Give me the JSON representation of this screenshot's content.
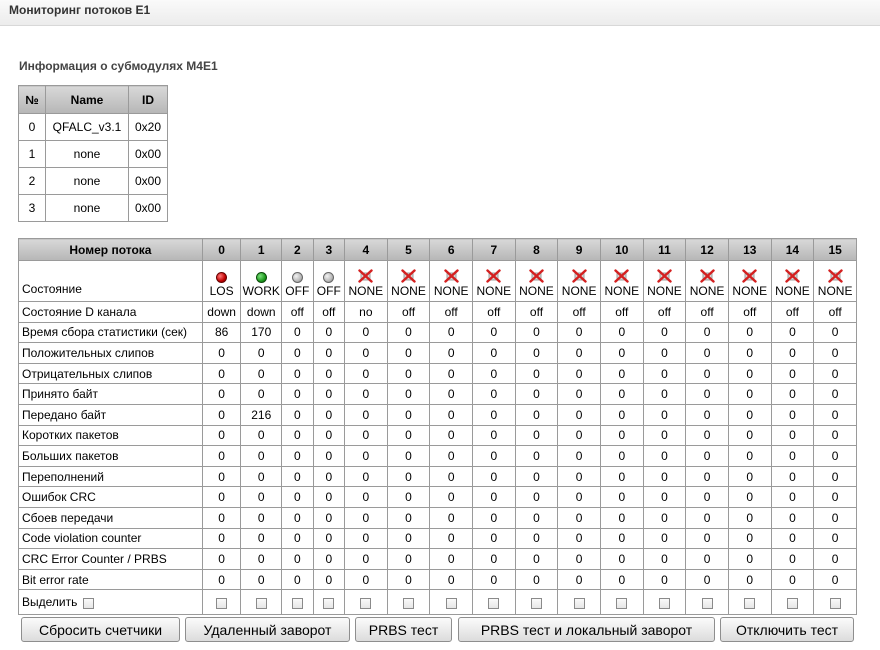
{
  "window": {
    "title": "Мониторинг потоков E1"
  },
  "submodules": {
    "heading": "Информация о субмодулях M4E1",
    "columns": [
      "№",
      "Name",
      "ID"
    ],
    "rows": [
      [
        "0",
        "QFALC_v3.1",
        "0x20"
      ],
      [
        "1",
        "none",
        "0x00"
      ],
      [
        "2",
        "none",
        "0x00"
      ],
      [
        "3",
        "none",
        "0x00"
      ]
    ]
  },
  "streams": {
    "header_label": "Номер потока",
    "numbers": [
      "0",
      "1",
      "2",
      "3",
      "4",
      "5",
      "6",
      "7",
      "8",
      "9",
      "10",
      "11",
      "12",
      "13",
      "14",
      "15"
    ],
    "state_label": "Состояние",
    "states": [
      {
        "icon": "red-indicator-icon",
        "text": "LOS"
      },
      {
        "icon": "green-indicator-icon",
        "text": "WORK"
      },
      {
        "icon": "gray-indicator-icon",
        "text": "OFF"
      },
      {
        "icon": "gray-indicator-icon",
        "text": "OFF"
      },
      {
        "icon": "cross-icon",
        "text": "NONE"
      },
      {
        "icon": "cross-icon",
        "text": "NONE"
      },
      {
        "icon": "cross-icon",
        "text": "NONE"
      },
      {
        "icon": "cross-icon",
        "text": "NONE"
      },
      {
        "icon": "cross-icon",
        "text": "NONE"
      },
      {
        "icon": "cross-icon",
        "text": "NONE"
      },
      {
        "icon": "cross-icon",
        "text": "NONE"
      },
      {
        "icon": "cross-icon",
        "text": "NONE"
      },
      {
        "icon": "cross-icon",
        "text": "NONE"
      },
      {
        "icon": "cross-icon",
        "text": "NONE"
      },
      {
        "icon": "cross-icon",
        "text": "NONE"
      },
      {
        "icon": "cross-icon",
        "text": "NONE"
      }
    ],
    "rows": [
      {
        "label": "Состояние D канала",
        "values": [
          "down",
          "down",
          "off",
          "off",
          "no",
          "off",
          "off",
          "off",
          "off",
          "off",
          "off",
          "off",
          "off",
          "off",
          "off",
          "off"
        ]
      },
      {
        "label": "Время сбора статистики (сек)",
        "values": [
          "86",
          "170",
          "0",
          "0",
          "0",
          "0",
          "0",
          "0",
          "0",
          "0",
          "0",
          "0",
          "0",
          "0",
          "0",
          "0"
        ]
      },
      {
        "label": "Положительных слипов",
        "values": [
          "0",
          "0",
          "0",
          "0",
          "0",
          "0",
          "0",
          "0",
          "0",
          "0",
          "0",
          "0",
          "0",
          "0",
          "0",
          "0"
        ]
      },
      {
        "label": "Отрицательных слипов",
        "values": [
          "0",
          "0",
          "0",
          "0",
          "0",
          "0",
          "0",
          "0",
          "0",
          "0",
          "0",
          "0",
          "0",
          "0",
          "0",
          "0"
        ]
      },
      {
        "label": "Принято байт",
        "values": [
          "0",
          "0",
          "0",
          "0",
          "0",
          "0",
          "0",
          "0",
          "0",
          "0",
          "0",
          "0",
          "0",
          "0",
          "0",
          "0"
        ]
      },
      {
        "label": "Передано байт",
        "values": [
          "0",
          "216",
          "0",
          "0",
          "0",
          "0",
          "0",
          "0",
          "0",
          "0",
          "0",
          "0",
          "0",
          "0",
          "0",
          "0"
        ]
      },
      {
        "label": "Коротких пакетов",
        "values": [
          "0",
          "0",
          "0",
          "0",
          "0",
          "0",
          "0",
          "0",
          "0",
          "0",
          "0",
          "0",
          "0",
          "0",
          "0",
          "0"
        ]
      },
      {
        "label": "Больших пакетов",
        "values": [
          "0",
          "0",
          "0",
          "0",
          "0",
          "0",
          "0",
          "0",
          "0",
          "0",
          "0",
          "0",
          "0",
          "0",
          "0",
          "0"
        ]
      },
      {
        "label": "Переполнений",
        "values": [
          "0",
          "0",
          "0",
          "0",
          "0",
          "0",
          "0",
          "0",
          "0",
          "0",
          "0",
          "0",
          "0",
          "0",
          "0",
          "0"
        ]
      },
      {
        "label": "Ошибок CRC",
        "values": [
          "0",
          "0",
          "0",
          "0",
          "0",
          "0",
          "0",
          "0",
          "0",
          "0",
          "0",
          "0",
          "0",
          "0",
          "0",
          "0"
        ]
      },
      {
        "label": "Сбоев передачи",
        "values": [
          "0",
          "0",
          "0",
          "0",
          "0",
          "0",
          "0",
          "0",
          "0",
          "0",
          "0",
          "0",
          "0",
          "0",
          "0",
          "0"
        ]
      },
      {
        "label": "Code violation counter",
        "values": [
          "0",
          "0",
          "0",
          "0",
          "0",
          "0",
          "0",
          "0",
          "0",
          "0",
          "0",
          "0",
          "0",
          "0",
          "0",
          "0"
        ]
      },
      {
        "label": "CRC Error Counter / PRBS",
        "values": [
          "0",
          "0",
          "0",
          "0",
          "0",
          "0",
          "0",
          "0",
          "0",
          "0",
          "0",
          "0",
          "0",
          "0",
          "0",
          "0"
        ]
      },
      {
        "label": "Bit error rate",
        "values": [
          "0",
          "0",
          "0",
          "0",
          "0",
          "0",
          "0",
          "0",
          "0",
          "0",
          "0",
          "0",
          "0",
          "0",
          "0",
          "0"
        ]
      }
    ],
    "select_label": "Выделить"
  },
  "buttons": {
    "reset": "Сбросить счетчики",
    "remote_loop": "Удаленный заворот",
    "prbs": "PRBS тест",
    "prbs_local": "PRBS тест и локальный заворот",
    "disable": "Отключить тест"
  },
  "colors": {
    "los": "#c00000",
    "work": "#1d9a1d",
    "off": "#b8b8b8",
    "none_cross": "#d42020"
  }
}
